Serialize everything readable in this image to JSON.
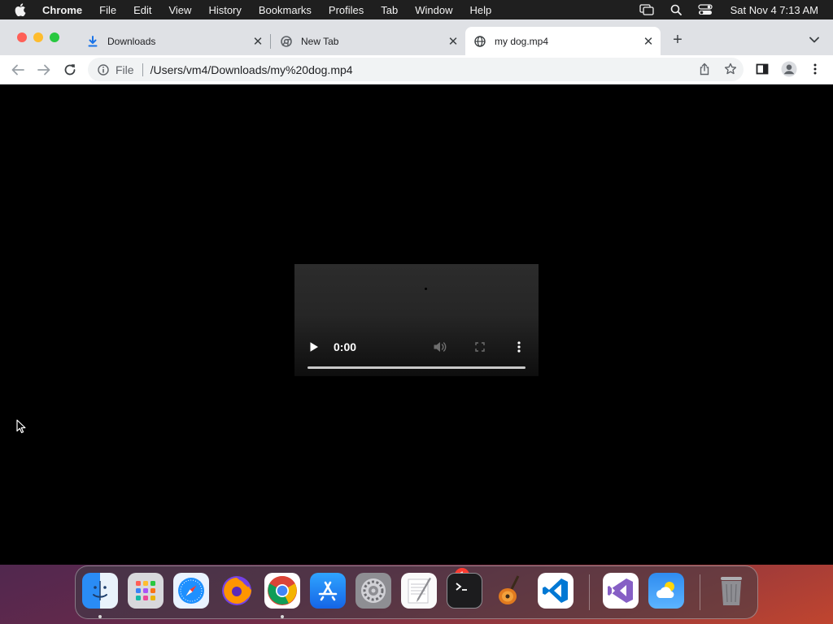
{
  "menubar": {
    "app_name": "Chrome",
    "items": [
      "File",
      "Edit",
      "View",
      "History",
      "Bookmarks",
      "Profiles",
      "Tab",
      "Window",
      "Help"
    ],
    "clock": "Sat Nov 4  7:13 AM"
  },
  "tabs": [
    {
      "title": "Downloads",
      "icon": "download-icon",
      "active": false
    },
    {
      "title": "New Tab",
      "icon": "chrome-icon",
      "active": false
    },
    {
      "title": "my dog.mp4",
      "icon": "globe-icon",
      "active": true
    }
  ],
  "omnibox": {
    "scheme_label": "File",
    "url": "/Users/vm4/Downloads/my%20dog.mp4"
  },
  "video": {
    "time": "0:00",
    "progress": 0
  },
  "dock": {
    "apps": [
      "Finder",
      "Launchpad",
      "Safari",
      "Firefox",
      "Google Chrome",
      "App Store",
      "System Settings",
      "TextEdit",
      "Terminal",
      "GarageBand",
      "Visual Studio Code",
      "Visual Studio",
      "Weather",
      "Trash"
    ],
    "settings_badge": "1"
  },
  "colors": {
    "tabstrip": "#dfe1e5",
    "toolbar": "#ffffff",
    "omnibox": "#f1f3f4",
    "page_background": "#000000",
    "menubar": "#1f1f1f"
  }
}
